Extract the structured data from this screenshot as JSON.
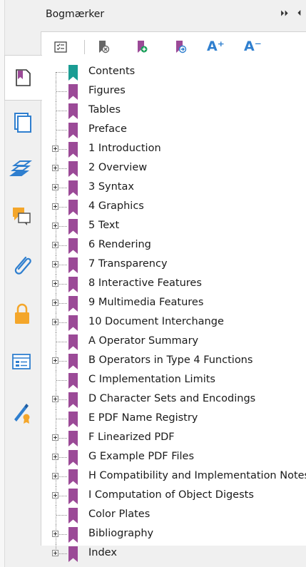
{
  "panel": {
    "title": "Bogmærker"
  },
  "colors": {
    "bookmark": "#9b4a97",
    "bookmark_current": "#1a9c93",
    "accent_orange": "#f4a62a",
    "accent_blue": "#2f7fcf"
  },
  "header_controls": [
    "⏵⏵",
    "⏴"
  ],
  "tabs": [
    {
      "icon": "bookmarks-panel-icon",
      "active": true
    },
    {
      "icon": "thumbnails-icon"
    },
    {
      "icon": "layers-icon"
    },
    {
      "icon": "comments-icon"
    },
    {
      "icon": "attachments-icon"
    },
    {
      "icon": "security-lock-icon"
    },
    {
      "icon": "form-fields-icon"
    },
    {
      "icon": "digital-signature-icon"
    }
  ],
  "toolbar": [
    {
      "icon": "bookmark-options-icon"
    },
    {
      "icon": "delete-bookmark-icon"
    },
    {
      "icon": "add-bookmark-icon"
    },
    {
      "icon": "bookmark-go-to-icon"
    },
    {
      "icon": "increase-font-icon",
      "text": "A⁺"
    },
    {
      "icon": "decrease-font-icon",
      "text": "A⁻"
    }
  ],
  "bookmarks": [
    {
      "label": "Contents",
      "expandable": false,
      "current": true
    },
    {
      "label": "Figures",
      "expandable": false
    },
    {
      "label": "Tables",
      "expandable": false
    },
    {
      "label": "Preface",
      "expandable": false
    },
    {
      "label": "1 Introduction",
      "expandable": true
    },
    {
      "label": "2 Overview",
      "expandable": true
    },
    {
      "label": "3 Syntax",
      "expandable": true
    },
    {
      "label": "4 Graphics",
      "expandable": true
    },
    {
      "label": "5 Text",
      "expandable": true
    },
    {
      "label": "6 Rendering",
      "expandable": true
    },
    {
      "label": "7 Transparency",
      "expandable": true
    },
    {
      "label": "8 Interactive Features",
      "expandable": true
    },
    {
      "label": "9 Multimedia Features",
      "expandable": true
    },
    {
      "label": "10 Document Interchange",
      "expandable": true
    },
    {
      "label": "A Operator Summary",
      "expandable": false
    },
    {
      "label": "B Operators in Type 4 Functions",
      "expandable": true
    },
    {
      "label": "C Implementation Limits",
      "expandable": false
    },
    {
      "label": "D Character Sets and Encodings",
      "expandable": true
    },
    {
      "label": "E PDF Name Registry",
      "expandable": false
    },
    {
      "label": "F Linearized PDF",
      "expandable": true
    },
    {
      "label": "G Example PDF Files",
      "expandable": true
    },
    {
      "label": "H Compatibility and Implementation Notes",
      "expandable": true
    },
    {
      "label": "I Computation of Object Digests",
      "expandable": true
    },
    {
      "label": "Color Plates",
      "expandable": false
    },
    {
      "label": "Bibliography",
      "expandable": true
    },
    {
      "label": "Index",
      "expandable": true
    }
  ]
}
